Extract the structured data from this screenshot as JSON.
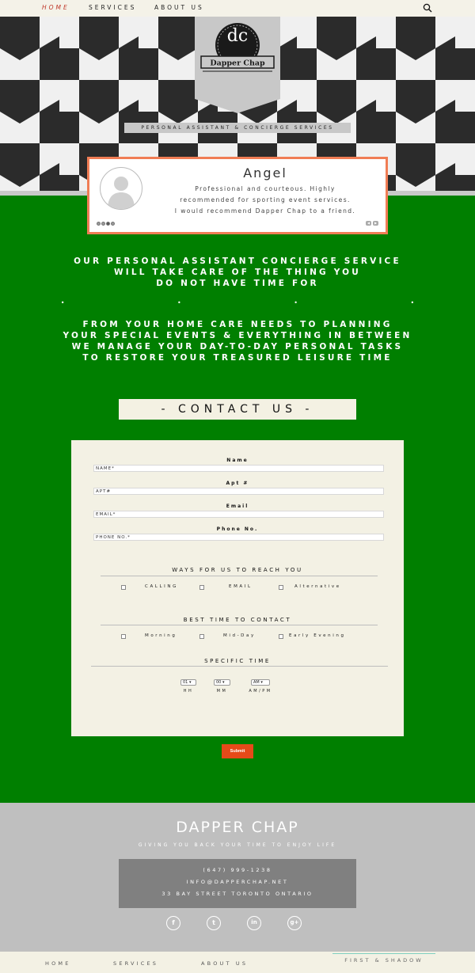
{
  "nav": {
    "items": [
      {
        "label": "HOME",
        "active": true
      },
      {
        "label": "SERVICES",
        "active": false
      },
      {
        "label": "ABOUT US",
        "active": false
      }
    ],
    "search_icon": "search-icon"
  },
  "hero": {
    "logo_monogram": "dc",
    "brand": "Dapper Chap",
    "tagline": "PERSONAL ASSISTANT & CONCIERGE SERVICES"
  },
  "testimonial": {
    "name": "Angel",
    "quote_lines": [
      "Professional and courteous. Highly",
      "recommended for sporting event services.",
      "I would recommend Dapper Chap to a friend."
    ],
    "slide_count": 4,
    "active_slide": 3
  },
  "intro": {
    "block1": [
      "OUR PERSONAL ASSISTANT CONCIERGE SERVICE",
      "WILL TAKE CARE OF THE THING YOU",
      "DO NOT HAVE TIME FOR"
    ],
    "bullets": "• • • •",
    "block2": [
      "FROM YOUR HOME CARE NEEDS TO PLANNING",
      "YOUR SPECIAL EVENTS & EVERYTHING IN BETWEEN",
      "WE MANAGE YOUR DAY-TO-DAY PERSONAL TASKS",
      "TO RESTORE YOUR TREASURED LEISURE TIME"
    ]
  },
  "contact": {
    "title": "- CONTACT US -",
    "fields": [
      {
        "label": "Name",
        "placeholder": "NAME*"
      },
      {
        "label": "Apt #",
        "placeholder": "APT#"
      },
      {
        "label": "Email",
        "placeholder": "EMAIL*"
      },
      {
        "label": "Phone No.",
        "placeholder": "PHONE NO.*"
      }
    ],
    "reach_title": "WAYS FOR US TO REACH YOU",
    "reach_options": [
      "CALLING",
      "EMAIL",
      "Alternative"
    ],
    "time_title": "BEST TIME TO CONTACT",
    "time_options": [
      "Morning",
      "Mid-Day",
      "Early Evening"
    ],
    "specific_title": "SPECIFIC TIME",
    "hh_value": "01",
    "mm_value": "00",
    "ampm_value": "AM",
    "hh_label": "HH",
    "mm_label": "MM",
    "ampm_label": "AM/PM",
    "submit_label": "Submit"
  },
  "footer": {
    "brand": "DAPPER CHAP",
    "tagline": "GIVING YOU BACK YOUR TIME TO ENJOY LIFE",
    "phone": "(647) 999-1238",
    "email": "INFO@DAPPERCHAP.NET",
    "address": "33 BAY STREET   TORONTO ONTARIO",
    "social": [
      {
        "icon": "facebook-icon",
        "glyph": "f"
      },
      {
        "icon": "twitter-icon",
        "glyph": "t"
      },
      {
        "icon": "linkedin-icon",
        "glyph": "in"
      },
      {
        "icon": "google-plus-icon",
        "glyph": "g+"
      }
    ]
  },
  "bottom_nav": {
    "items": [
      "HOME",
      "SERVICES",
      "ABOUT US"
    ],
    "credit": "FIRST & SHADOW"
  },
  "colors": {
    "green": "#007f00",
    "accent": "#e64a19",
    "card_border": "#f07d55",
    "cream": "#f3f1e4"
  }
}
